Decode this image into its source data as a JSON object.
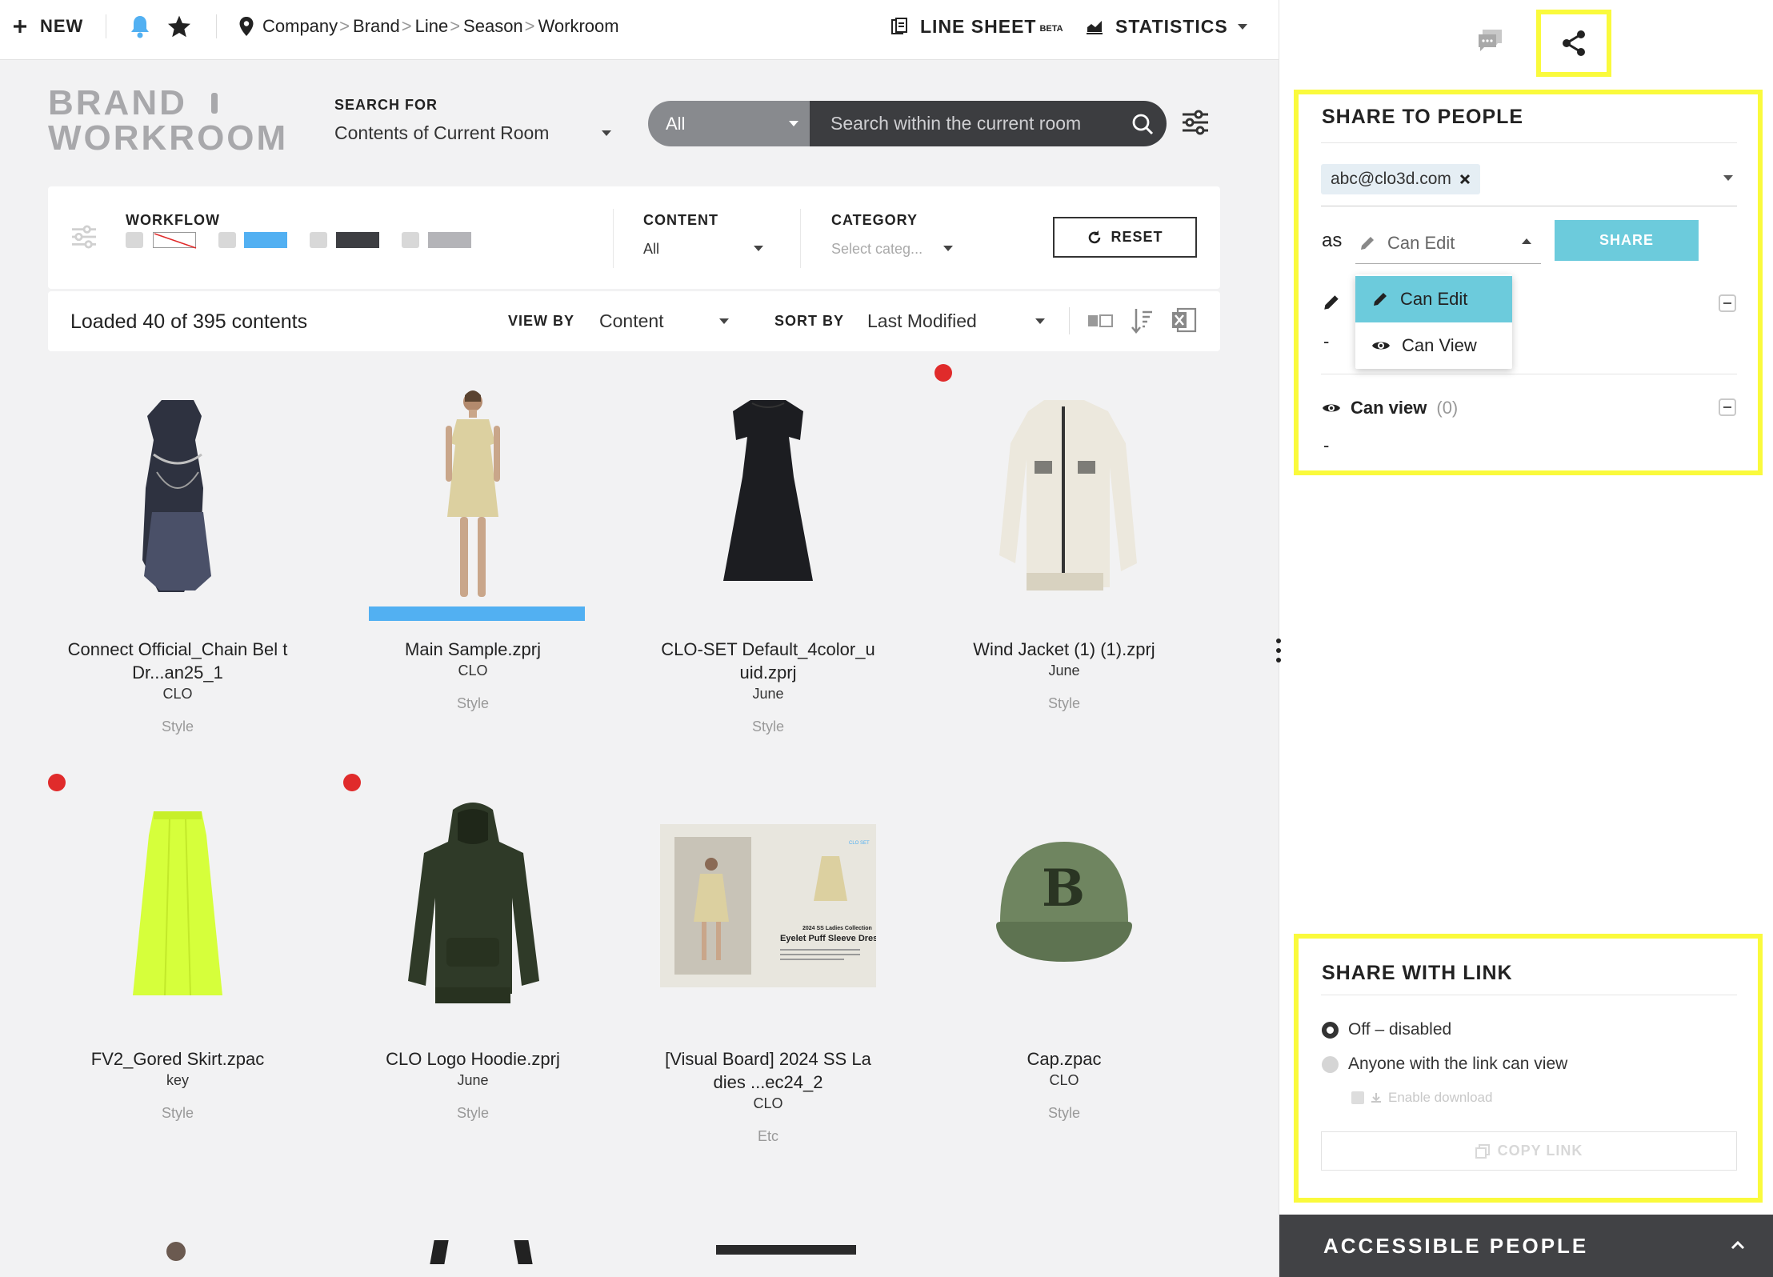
{
  "topbar": {
    "new_label": "NEW",
    "breadcrumb": [
      {
        "label": "Company",
        "sep": ">"
      },
      {
        "label": "Brand",
        "sep": ">"
      },
      {
        "label": "Line",
        "sep": ">"
      },
      {
        "label": "Season",
        "sep": ">"
      },
      {
        "label": "Workroom",
        "sep": ""
      }
    ],
    "line_sheet": "LINE SHEET",
    "line_sheet_badge": "BETA",
    "statistics": "STATISTICS"
  },
  "main": {
    "brand_title_1": "BRAND",
    "brand_title_2": "WORKROOM",
    "search_for_label": "SEARCH FOR",
    "search_for_value": "Contents of Current Room",
    "search_scope": "All",
    "search_placeholder": "Search within the current room",
    "filters": {
      "workflow_label": "WORKFLOW",
      "content_label": "CONTENT",
      "content_value": "All",
      "category_label": "CATEGORY",
      "category_placeholder": "Select categ...",
      "reset_label": "RESET"
    },
    "loaded": {
      "prefix": "Loaded ",
      "loaded_count": "40",
      "middle": " of ",
      "total_count": "395",
      "suffix": " contents",
      "view_by_label": "VIEW BY",
      "view_by_value": "Content",
      "sort_by_label": "SORT BY",
      "sort_by_value": "Last Modified"
    },
    "cards": [
      {
        "name": "Connect Official_Chain Bel t Dr...an25_1",
        "owner": "CLO",
        "type": "Style",
        "image": "dark-chain-dress",
        "flag": false,
        "progress": 0
      },
      {
        "name": "Main Sample.zprj",
        "owner": "CLO",
        "type": "Style",
        "image": "avatar-sample-dress",
        "flag": false,
        "progress": 1
      },
      {
        "name": "CLO-SET Default_4color_u uid.zprj",
        "owner": "June",
        "type": "Style",
        "image": "black-puff-dress",
        "flag": false,
        "progress": 0
      },
      {
        "name": "Wind Jacket (1) (1).zprj",
        "owner": "June",
        "type": "Style",
        "image": "cream-wind-jacket",
        "flag": true,
        "progress": 0
      },
      {
        "name": "FV2_Gored Skirt.zpac",
        "owner": "key",
        "type": "Style",
        "image": "neon-gored-skirt",
        "flag": true,
        "progress": 0
      },
      {
        "name": "CLO Logo Hoodie.zprj",
        "owner": "June",
        "type": "Style",
        "image": "olive-hoodie",
        "flag": true,
        "progress": 0
      },
      {
        "name": "[Visual Board] 2024 SS La dies ...ec24_2",
        "owner": "CLO",
        "type": "Etc",
        "image": "visual-board",
        "flag": false,
        "progress": 0
      },
      {
        "name": "Cap.zpac",
        "owner": "CLO",
        "type": "Style",
        "image": "green-b-cap",
        "flag": false,
        "progress": 0
      }
    ],
    "visual_board": {
      "collection": "2024 SS Ladies Collection",
      "title": "Eyelet Puff Sleeve Dress",
      "logo": "CLO SET"
    }
  },
  "share_panel": {
    "share_to_people_title": "SHARE TO PEOPLE",
    "email_chip": "abc@clo3d.com",
    "as_label": "as",
    "permission_value": "Can Edit",
    "share_button": "SHARE",
    "dropdown_options": [
      "Can Edit",
      "Can View"
    ],
    "dropdown_selected": 0,
    "can_edit_dash": "-",
    "can_view_label": "Can view",
    "can_view_count": "(0)",
    "can_view_dash": "-",
    "share_with_link_title": "SHARE WITH LINK",
    "link_options": [
      "Off – disabled",
      "Anyone with the link can view"
    ],
    "link_selected": 0,
    "enable_download": "Enable download",
    "copy_link": "COPY LINK",
    "accessible_people": "ACCESSIBLE PEOPLE"
  },
  "colors": {
    "accent_blue": "#52b0f2",
    "share_button": "#6ccbdc",
    "highlight_yellow": "#fafa3c",
    "flag_red": "#e02b2b",
    "workflow": [
      "#ffffff",
      "#52b0f2",
      "#3d3e42",
      "#b4b4b8"
    ]
  }
}
